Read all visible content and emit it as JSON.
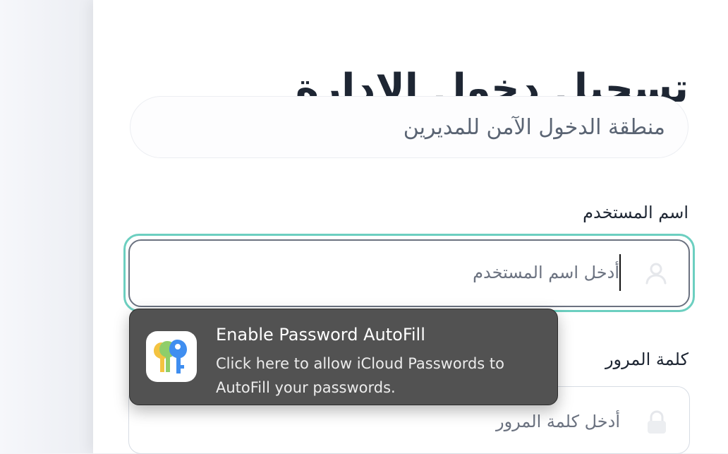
{
  "login": {
    "title": "تسجيل دخول الإدارة",
    "subtitle": "منطقة الدخول الآمن للمديرين",
    "username": {
      "label": "اسم المستخدم",
      "placeholder": "أدخل اسم المستخدم",
      "icon": "user-icon"
    },
    "password": {
      "label": "كلمة المرور",
      "placeholder": "أدخل كلمة المرور",
      "icon": "lock-icon"
    }
  },
  "autofill_popup": {
    "icon": "passwords-app-icon",
    "title": "Enable Password AutoFill",
    "body": "Click here to allow iCloud Passwords to AutoFill your passwords."
  },
  "colors": {
    "focus_ring": "#6ccfc0",
    "title_text": "#1e2633",
    "popup_background": "#525252"
  }
}
